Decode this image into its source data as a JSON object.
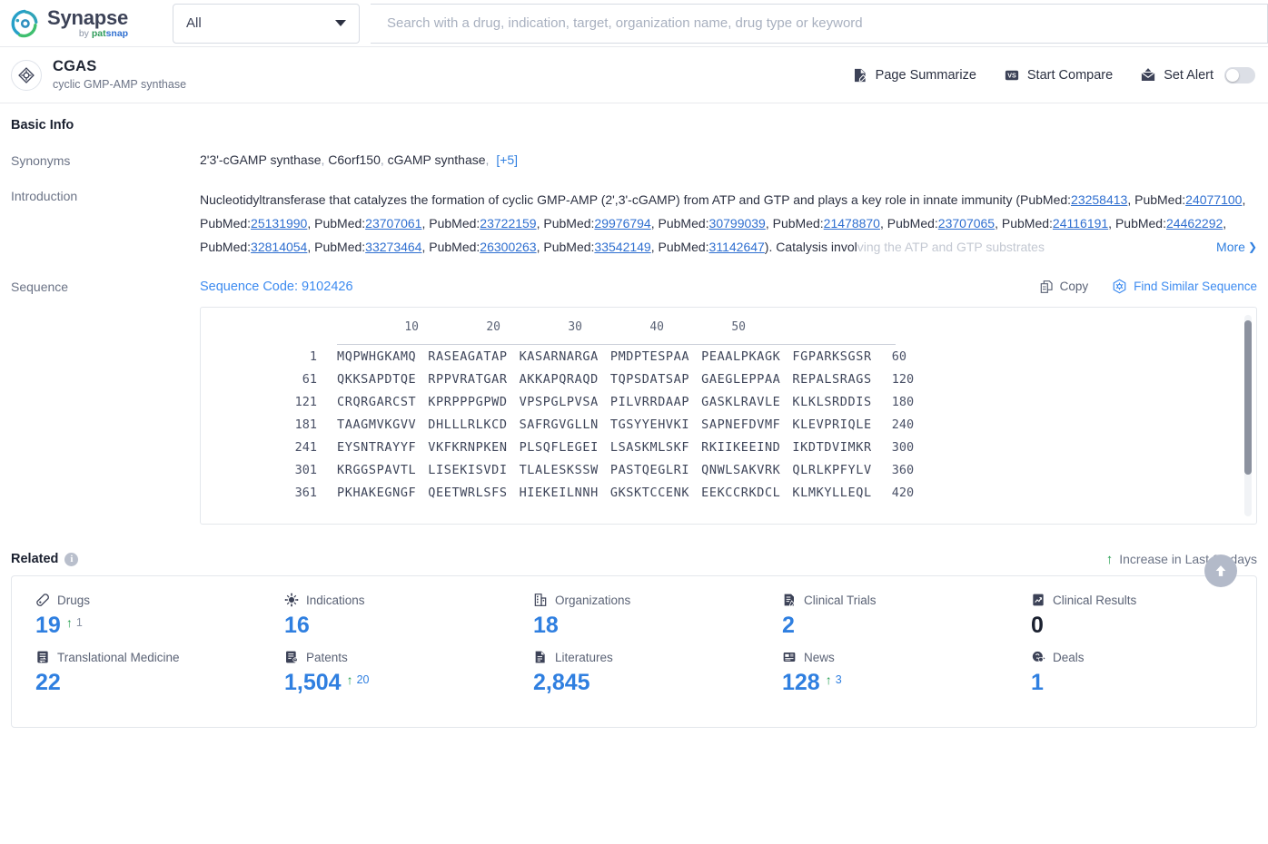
{
  "topbar": {
    "logo": {
      "name": "Synapse",
      "by": "by",
      "pat": "pat",
      "snap": "snap"
    },
    "scope": {
      "value": "All",
      "icon": "chevron-down-icon"
    },
    "search": {
      "value": "",
      "placeholder": "Search with a drug, indication, target, organization name, drug type or keyword"
    }
  },
  "entity": {
    "icon": "target-icon",
    "name": "CGAS",
    "alias": "cyclic GMP-AMP synthase",
    "actions": [
      {
        "label": "Page Summarize",
        "icon": "page-summarize-icon"
      },
      {
        "label": "Start Compare",
        "icon": "vs-badge-icon"
      },
      {
        "label": "Set Alert",
        "icon": "alert-envelope-icon",
        "toggle": "off"
      }
    ]
  },
  "basic_info": {
    "title": "Basic Info",
    "synonyms": {
      "label": "Synonyms",
      "items": [
        "2'3'-cGAMP synthase",
        "C6orf150",
        "cGAMP synthase"
      ],
      "more": "[+5]"
    },
    "introduction": {
      "label": "Introduction",
      "text_before": "Nucleotidyltransferase that catalyzes the formation of cyclic GMP-AMP (2',3'-cGAMP) from ATP and GTP and plays a key role in innate immunity (PubMed:",
      "pubmed_prefix": "PubMed:",
      "pmids": [
        "23258413",
        "24077100",
        "25131990",
        "23707061",
        "23722159",
        "29976794",
        "30799039",
        "21478870",
        "23707065",
        "24116191",
        "24462292",
        "32814054",
        "33273464",
        "26300263",
        "33542149",
        "31142647"
      ],
      "text_after": "). Catalysis invol",
      "more_label": "More",
      "more_icon": "chevron-double-down-icon"
    },
    "sequence": {
      "label": "Sequence",
      "code_label": "Sequence Code: 9102426",
      "copy_label": "Copy",
      "copy_icon": "copy-icon",
      "find_similar_label": "Find Similar Sequence",
      "find_similar_icon": "find-similar-icon",
      "ruler": [
        "10",
        "20",
        "30",
        "40",
        "50"
      ],
      "rows": [
        {
          "start": "1",
          "end": "60",
          "chunks": [
            "MQPWHGKAMQ",
            "RASEAGATAP",
            "KASARNARGA",
            "PMDPTESPAA",
            "PEAALPKAGK",
            "FGPARKSGSR"
          ]
        },
        {
          "start": "61",
          "end": "120",
          "chunks": [
            "QKKSAPDTQE",
            "RPPVRATGAR",
            "AKKAPQRAQD",
            "TQPSDATSAP",
            "GAEGLEPPAA",
            "REPALSRAGS"
          ]
        },
        {
          "start": "121",
          "end": "180",
          "chunks": [
            "CRQRGARCST",
            "KPRPPPGPWD",
            "VPSPGLPVSA",
            "PILVRRDAAP",
            "GASKLRAVLE",
            "KLKLSRDDIS"
          ]
        },
        {
          "start": "181",
          "end": "240",
          "chunks": [
            "TAAGMVKGVV",
            "DHLLLRLKCD",
            "SAFRGVGLLN",
            "TGSYYEHVKI",
            "SAPNEFDVMF",
            "KLEVPRIQLE"
          ]
        },
        {
          "start": "241",
          "end": "300",
          "chunks": [
            "EYSNTRAYYF",
            "VKFKRNPKEN",
            "PLSQFLEGEI",
            "LSASKMLSKF",
            "RKIIKEEIND",
            "IKDTDVIMKR"
          ]
        },
        {
          "start": "301",
          "end": "360",
          "chunks": [
            "KRGGSPAVTL",
            "LISEKISVDI",
            "TLALESKSSW",
            "PASTQEGLRI",
            "QNWLSAKVRK",
            "QLRLKPFYLV"
          ]
        },
        {
          "start": "361",
          "end": "420",
          "chunks": [
            "PKHAKEGNGF",
            "QEETWRLSFS",
            "HIEKEILNNH",
            "GKSKTCCENK",
            "EEKCCRKDCL",
            "KLMKYLLEQL"
          ]
        }
      ]
    }
  },
  "related": {
    "title": "Related",
    "info_icon": "info-icon",
    "legend": {
      "arrow_icon": "up-arrow-icon",
      "label": "Increase in Last 30 days"
    },
    "to_top_icon": "scroll-to-top-icon",
    "stats": [
      {
        "label": "Drugs",
        "icon": "pill-icon",
        "value": "19",
        "delta": "1",
        "delta_color": "gray"
      },
      {
        "label": "Indications",
        "icon": "virus-icon",
        "value": "16",
        "delta": "",
        "delta_color": ""
      },
      {
        "label": "Organizations",
        "icon": "building-icon",
        "value": "18",
        "delta": "",
        "delta_color": ""
      },
      {
        "label": "Clinical Trials",
        "icon": "clinical-trial-icon",
        "value": "2",
        "delta": "",
        "delta_color": ""
      },
      {
        "label": "Clinical Results",
        "icon": "clinical-result-icon",
        "value": "0",
        "delta": "",
        "delta_color": ""
      },
      {
        "label": "Translational Medicine",
        "icon": "translational-icon",
        "value": "22",
        "delta": "",
        "delta_color": ""
      },
      {
        "label": "Patents",
        "icon": "patent-icon",
        "value": "1,504",
        "delta": "20",
        "delta_color": "blue"
      },
      {
        "label": "Literatures",
        "icon": "literature-icon",
        "value": "2,845",
        "delta": "",
        "delta_color": ""
      },
      {
        "label": "News",
        "icon": "news-icon",
        "value": "128",
        "delta": "3",
        "delta_color": "blue"
      },
      {
        "label": "Deals",
        "icon": "deals-icon",
        "value": "1",
        "delta": "",
        "delta_color": ""
      }
    ]
  }
}
